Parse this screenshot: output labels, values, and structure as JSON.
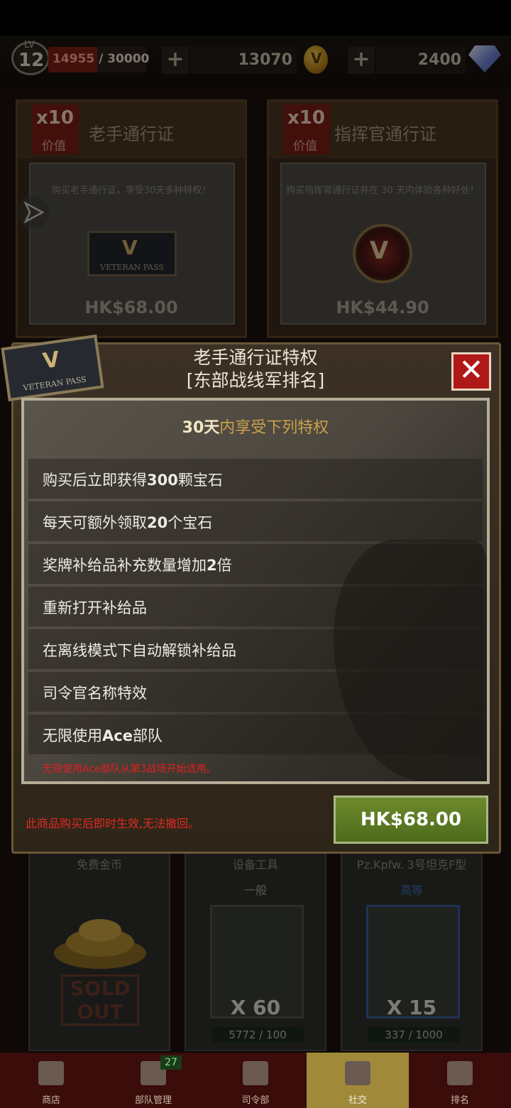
{
  "status": {
    "level_label": "LV",
    "level": "12",
    "xp_current": "14955",
    "xp_sep": " / ",
    "xp_max": "30000",
    "xp_fraction": 0.4985,
    "gold": "13070",
    "gems": "2400",
    "plus": "+"
  },
  "background": {
    "passes": [
      {
        "mult": "x10",
        "value_label": "价值",
        "title": "老手通行证",
        "desc": "购买老手通行证，享受30天多种特权！",
        "price": "HK$68.00",
        "emblem_text": "VETERAN PASS"
      },
      {
        "mult": "x10",
        "value_label": "价值",
        "title": "指挥官通行证",
        "desc": "购买指挥官通行证并在 30 天内体验各种好处！",
        "price": "HK$44.90"
      }
    ],
    "items": [
      {
        "name": "免费金币",
        "sold_out": "SOLD OUT"
      },
      {
        "name": "设备工具",
        "rarity": "一般",
        "qty": "X 60",
        "progress": "5772 / 100"
      },
      {
        "name": "Pz.Kpfw. 3号坦克F型",
        "rarity": "高等",
        "qty": "X 15",
        "progress": "337 / 1000"
      }
    ]
  },
  "modal": {
    "title_line1": "老手通行证特权",
    "title_line2": "[东部战线军排名]",
    "badge_text": "VETERAN PASS",
    "close": "✕",
    "header_days": "30天",
    "header_rest": "内享受下列特权",
    "perks": [
      {
        "pre": "购买后立即获得",
        "bold": "300",
        "post": "颗宝石"
      },
      {
        "pre": "每天可额外领取",
        "bold": "20",
        "post": "个宝石"
      },
      {
        "pre": "奖牌补给品补充数量增加",
        "bold": "2",
        "post": "倍"
      },
      {
        "pre": "重新打开补给品",
        "bold": "",
        "post": ""
      },
      {
        "pre": "在离线模式下自动解锁补给品",
        "bold": "",
        "post": ""
      },
      {
        "pre": "司令官名称特效",
        "bold": "",
        "post": ""
      },
      {
        "pre": "无限使用",
        "bold": "Ace",
        "post": "部队"
      }
    ],
    "note": "无限使用Ace部队从第3战场开始适用。",
    "warning": "此商品购买后即时生效,无法撤回。",
    "buy_price": "HK$68.00"
  },
  "nav": {
    "items": [
      {
        "label": "商店",
        "icon": "box-icon"
      },
      {
        "label": "部队管理",
        "icon": "cards-icon",
        "badge": "27"
      },
      {
        "label": "司令部",
        "icon": "hq-icon"
      },
      {
        "label": "社交",
        "icon": "people-icon",
        "active": true
      },
      {
        "label": "排名",
        "icon": "trophy-icon"
      }
    ]
  },
  "colors": {
    "accent_red": "#b01818",
    "buy_green": "#5d7a24",
    "warning_red": "#e22a20",
    "gold_text": "#c9a14c"
  }
}
